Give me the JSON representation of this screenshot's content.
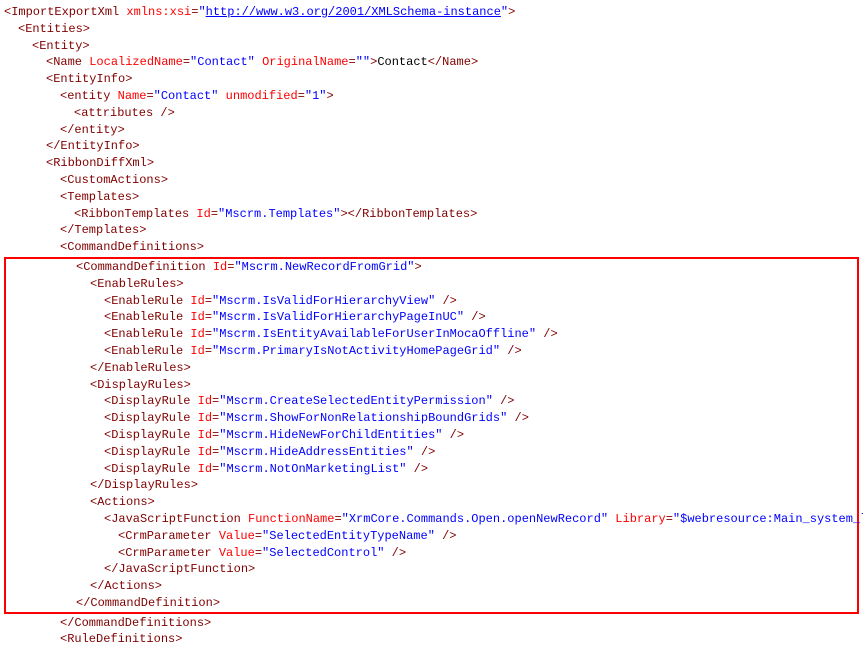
{
  "root": {
    "open": "<ImportExportXml",
    "attr1_name": " xmlns:xsi",
    "eq": "=",
    "q": "\"",
    "url": "http://www.w3.org/2001/XMLSchema-instance",
    "close": ">"
  },
  "entities_open": "<Entities>",
  "entity_open": "<Entity>",
  "name_line": {
    "open": "<Name",
    "a1": " LocalizedName",
    "v1": "Contact",
    "a2": " OriginalName",
    "v2": "",
    "mid": ">",
    "text": "Contact",
    "close": "</Name>"
  },
  "entityinfo_open": "<EntityInfo>",
  "entity_tag": {
    "open": "<entity",
    "a1": " Name",
    "v1": "Contact",
    "a2": " unmodified",
    "v2": "1",
    "close": ">"
  },
  "attributes_sc": "<attributes />",
  "entity_close": "</entity>",
  "entityinfo_close": "</EntityInfo>",
  "ribbondiff_open": "<RibbonDiffXml>",
  "customactions": "<CustomActions>",
  "templates_open": "<Templates>",
  "ribbontemplates": {
    "open": "<RibbonTemplates",
    "a1": " Id",
    "v1": "Mscrm.Templates",
    "mid": ">",
    "close": "</RibbonTemplates>"
  },
  "templates_close": "</Templates>",
  "cmddefs_open": "<CommandDefinitions>",
  "cmd_open": {
    "open": "<CommandDefinition",
    "a1": " Id",
    "v1": "Mscrm.NewRecordFromGrid",
    "close": ">"
  },
  "enablerules_open": "<EnableRules>",
  "er1": {
    "open": "<EnableRule",
    "a1": " Id",
    "v1": "Mscrm.IsValidForHierarchyView",
    "close": " />"
  },
  "er2": {
    "open": "<EnableRule",
    "a1": " Id",
    "v1": "Mscrm.IsValidForHierarchyPageInUC",
    "close": " />"
  },
  "er3": {
    "open": "<EnableRule",
    "a1": " Id",
    "v1": "Mscrm.IsEntityAvailableForUserInMocaOffline",
    "close": " />"
  },
  "er4": {
    "open": "<EnableRule",
    "a1": " Id",
    "v1": "Mscrm.PrimaryIsNotActivityHomePageGrid",
    "close": " />"
  },
  "enablerules_close": "</EnableRules>",
  "displayrules_open": "<DisplayRules>",
  "dr1": {
    "open": "<DisplayRule",
    "a1": " Id",
    "v1": "Mscrm.CreateSelectedEntityPermission",
    "close": " />"
  },
  "dr2": {
    "open": "<DisplayRule",
    "a1": " Id",
    "v1": "Mscrm.ShowForNonRelationshipBoundGrids",
    "close": " />"
  },
  "dr3": {
    "open": "<DisplayRule",
    "a1": " Id",
    "v1": "Mscrm.HideNewForChildEntities",
    "close": " />"
  },
  "dr4": {
    "open": "<DisplayRule",
    "a1": " Id",
    "v1": "Mscrm.HideAddressEntities",
    "close": " />"
  },
  "dr5": {
    "open": "<DisplayRule",
    "a1": " Id",
    "v1": "Mscrm.NotOnMarketingList",
    "close": " />"
  },
  "displayrules_close": "</DisplayRules>",
  "actions_open": "<Actions>",
  "jsfunc": {
    "open": "<JavaScriptFunction",
    "a1": " FunctionName",
    "v1": "XrmCore.Commands.Open.openNewRecord",
    "a2": " Library",
    "v2": "$webresource:Main_system_library.js",
    "close": ">"
  },
  "crmparam1": {
    "open": "<CrmParameter",
    "a1": " Value",
    "v1": "SelectedEntityTypeName",
    "close": " />"
  },
  "crmparam2": {
    "open": "<CrmParameter",
    "a1": " Value",
    "v1": "SelectedControl",
    "close": " />"
  },
  "jsfunc_close": "</JavaScriptFunction>",
  "actions_close": "</Actions>",
  "cmd_close": "</CommandDefinition>",
  "cmddefs_close": "</CommandDefinitions>",
  "ruledefs_open": "<RuleDefinitions>"
}
